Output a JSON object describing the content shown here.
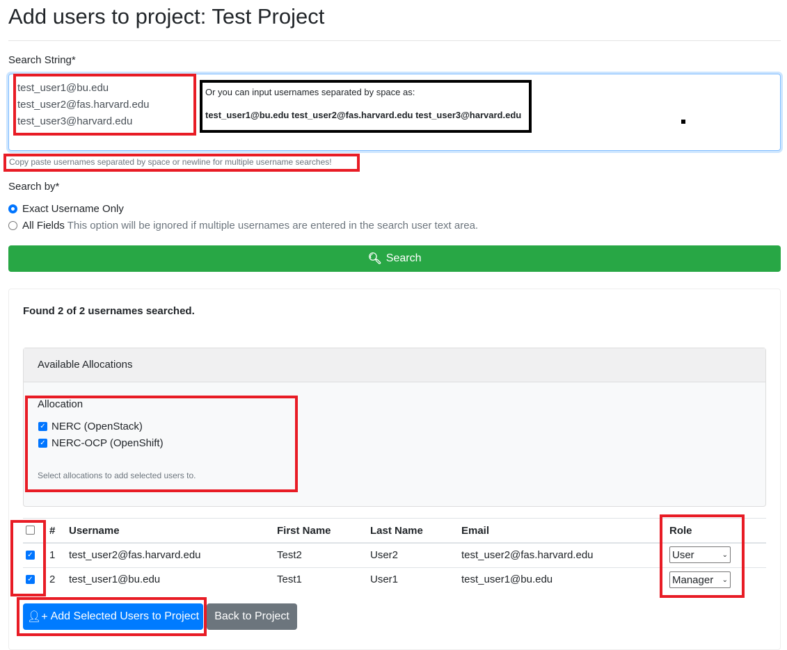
{
  "title": "Add users to project: Test Project",
  "search": {
    "label": "Search String*",
    "lines": [
      "test_user1@bu.edu",
      "test_user2@fas.harvard.edu",
      "test_user3@harvard.edu"
    ],
    "note_line1": "Or you can input usernames separated by space as:",
    "note_line2": "test_user1@bu.edu test_user2@fas.harvard.edu test_user3@harvard.edu",
    "help": "Copy paste usernames separated by space or newline for multiple username searches!"
  },
  "search_by": {
    "label": "Search by*",
    "options": [
      {
        "label": "Exact Username Only",
        "selected": true
      },
      {
        "label": "All Fields",
        "hint": "This option will be ignored if multiple usernames are entered in the search user text area.",
        "selected": false
      }
    ]
  },
  "search_button": "Search",
  "results": {
    "found": "Found 2 of 2 usernames searched.",
    "allocations_header": "Available Allocations",
    "allocation_label": "Allocation",
    "allocations": [
      {
        "label": "NERC (OpenStack)",
        "checked": true
      },
      {
        "label": "NERC-OCP (OpenShift)",
        "checked": true
      }
    ],
    "allocation_help": "Select allocations to add selected users to.",
    "columns": [
      "#",
      "Username",
      "First Name",
      "Last Name",
      "Email",
      "Role"
    ],
    "rows": [
      {
        "n": "1",
        "username": "test_user2@fas.harvard.edu",
        "first": "Test2",
        "last": "User2",
        "email": "test_user2@fas.harvard.edu",
        "role": "User",
        "checked": true
      },
      {
        "n": "2",
        "username": "test_user1@bu.edu",
        "first": "Test1",
        "last": "User1",
        "email": "test_user1@bu.edu",
        "role": "Manager",
        "checked": true
      }
    ]
  },
  "buttons": {
    "add": "Add Selected Users to Project",
    "back": "Back to Project"
  },
  "colors": {
    "primary": "#007bff",
    "success": "#28a745",
    "secondary": "#6c757d",
    "annotation": "#e81c25"
  }
}
